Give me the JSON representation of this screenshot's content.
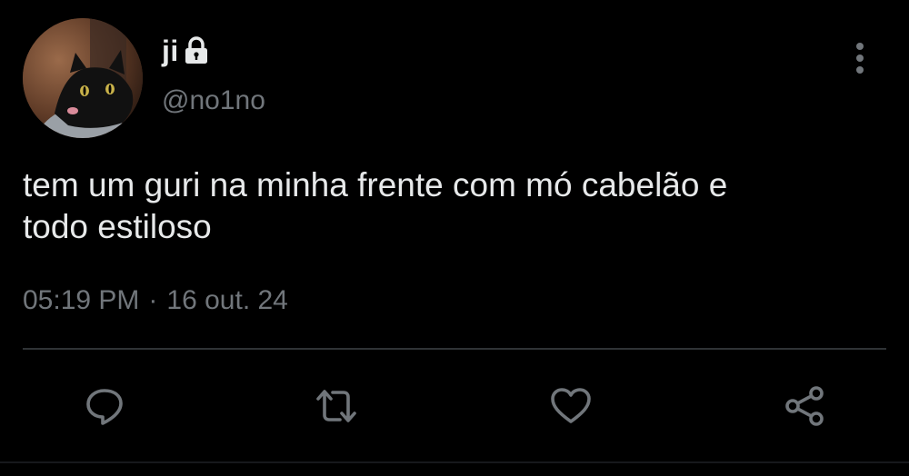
{
  "user": {
    "display_name": "ji",
    "handle": "@no1no",
    "avatar_icon": "black-cat-avatar",
    "protected_icon": "lock-icon"
  },
  "tweet": {
    "text": "tem um guri na minha frente com mó cabelão e\ntodo estiloso",
    "time": "05:19 PM",
    "separator": "·",
    "date": "16 out. 24"
  },
  "actions": [
    {
      "name": "reply",
      "icon": "comment-icon"
    },
    {
      "name": "retweet",
      "icon": "retweet-icon"
    },
    {
      "name": "like",
      "icon": "heart-icon"
    },
    {
      "name": "share",
      "icon": "share-icon"
    }
  ],
  "colors": {
    "background": "#000000",
    "text_primary": "#e7e9ea",
    "text_secondary": "#71767b",
    "divider": "#2f3336",
    "icon": "#71767b"
  }
}
